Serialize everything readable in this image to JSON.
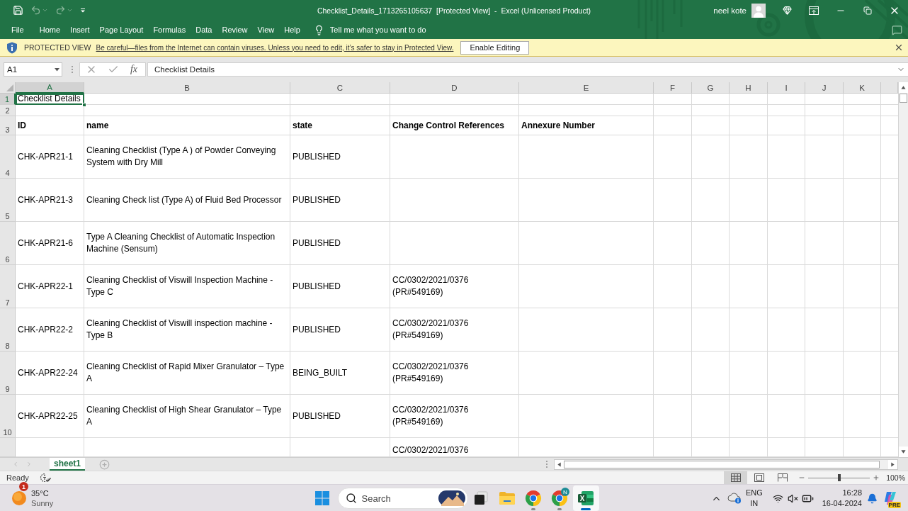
{
  "title_bar": {
    "quick_access": [
      {
        "kind": "save",
        "disabled": false
      },
      {
        "kind": "undo",
        "disabled": true
      },
      {
        "kind": "redo",
        "disabled": true
      }
    ],
    "title": "Checklist_Details_1713265105637  [Protected View]  -  Excel (Unlicensed Product)",
    "user": "neel kote"
  },
  "ribbon": {
    "tabs": [
      "File",
      "Home",
      "Insert",
      "Page Layout",
      "Formulas",
      "Data",
      "Review",
      "View",
      "Help"
    ],
    "tell_me": "Tell me what you want to do"
  },
  "protected_view": {
    "label": "PROTECTED VIEW",
    "message": "Be careful—files from the Internet can contain viruses. Unless you need to edit, it’s safer to stay in Protected View.",
    "button": "Enable Editing"
  },
  "formula_bar": {
    "name_box": "A1",
    "function_button": "fx",
    "formula": "Checklist Details"
  },
  "sheet": {
    "columns": [
      {
        "label": "A",
        "selected": true
      },
      {
        "label": "B",
        "selected": false
      },
      {
        "label": "C",
        "selected": false
      },
      {
        "label": "D",
        "selected": false
      },
      {
        "label": "E",
        "selected": false
      },
      {
        "label": "F",
        "selected": false
      },
      {
        "label": "G",
        "selected": false
      },
      {
        "label": "H",
        "selected": false
      },
      {
        "label": "I",
        "selected": false
      },
      {
        "label": "J",
        "selected": false
      },
      {
        "label": "K",
        "selected": false
      }
    ],
    "rows": [
      {
        "number": "1",
        "selected": true,
        "kind": "title",
        "title": "Checklist Details"
      },
      {
        "number": "2",
        "selected": false,
        "kind": "blank"
      },
      {
        "number": "3",
        "selected": false,
        "kind": "header",
        "id": "ID",
        "name": "name",
        "state": "state",
        "change_control_references": "Change Control References",
        "annexure_number": "Annexure Number"
      },
      {
        "number": "4",
        "selected": false,
        "kind": "record",
        "id": "CHK-APR21-1",
        "name": "Cleaning Checklist (Type A ) of Powder Conveying System with Dry Mill",
        "state": "PUBLISHED"
      },
      {
        "number": "5",
        "selected": false,
        "kind": "record",
        "id": "CHK-APR21-3",
        "name": "Cleaning Check list (Type A) of Fluid Bed Processor",
        "state": "PUBLISHED"
      },
      {
        "number": "6",
        "selected": false,
        "kind": "record",
        "id": "CHK-APR21-6",
        "name": "Type A Cleaning Checklist of Automatic Inspection Machine (Sensum)",
        "state": "PUBLISHED"
      },
      {
        "number": "7",
        "selected": false,
        "kind": "record",
        "id": "CHK-APR22-1",
        "name": "Cleaning Checklist of Viswill Inspection Machine - Type C",
        "state": "PUBLISHED",
        "change_control_references": "CC/0302/2021/0376 (PR#549169)"
      },
      {
        "number": "8",
        "selected": false,
        "kind": "record",
        "id": "CHK-APR22-2",
        "name": "Cleaning Checklist of Viswill inspection machine - Type B",
        "state": "PUBLISHED",
        "change_control_references": "CC/0302/2021/0376 (PR#549169)"
      },
      {
        "number": "9",
        "selected": false,
        "kind": "record",
        "id": "CHK-APR22-24",
        "name": "Cleaning Checklist of Rapid Mixer Granulator – Type A",
        "state": "BEING_BUILT",
        "change_control_references": "CC/0302/2021/0376 (PR#549169)"
      },
      {
        "number": "10",
        "selected": false,
        "kind": "record",
        "id": "CHK-APR22-25",
        "name": "Cleaning Checklist of High Shear Granulator – Type A",
        "state": "PUBLISHED",
        "change_control_references": "CC/0302/2021/0376 (PR#549169)"
      },
      {
        "selected": false,
        "kind": "partial",
        "change_control_references": "CC/0302/2021/0376"
      }
    ]
  },
  "sheet_tabs": [
    {
      "label": "sheet1",
      "selected": true
    }
  ],
  "status_bar": {
    "status": "Ready",
    "views": [
      {
        "kind": "normal",
        "selected": true
      },
      {
        "kind": "page_layout",
        "selected": false
      },
      {
        "kind": "page_break",
        "selected": false
      }
    ],
    "zoom": {
      "level": 0.5,
      "reading": "100%"
    }
  },
  "taskbar": {
    "weather": {
      "badge": "1",
      "temperature": "35°C",
      "condition": "Sunny"
    },
    "search": {
      "placeholder": "Search"
    },
    "apps": [
      {
        "kind": "task_view",
        "running": false,
        "selected": false
      },
      {
        "kind": "file_explorer",
        "running": false,
        "selected": false
      },
      {
        "kind": "browser",
        "running": true,
        "selected": false
      },
      {
        "kind": "browser",
        "running": true,
        "selected": false,
        "badge": "N"
      },
      {
        "kind": "spreadsheet",
        "running": true,
        "selected": true,
        "glyph": "X"
      }
    ],
    "tray": {
      "language": "ENG",
      "region": "IN",
      "time": "16:28",
      "date": "16-04-2024",
      "copilot_badge": "PRE"
    }
  }
}
